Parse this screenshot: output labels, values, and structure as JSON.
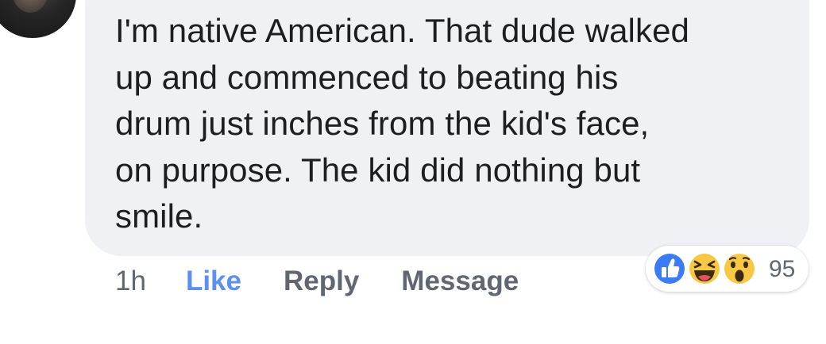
{
  "comment": {
    "lines": [
      "I'm native American. That dude walked",
      "up and commenced to beating his",
      "drum just inches from the kid's face,",
      "on purpose. The kid did nothing but",
      "smile."
    ]
  },
  "actions": {
    "time": "1h",
    "like": "Like",
    "reply": "Reply",
    "message": "Message"
  },
  "reactions": {
    "types": [
      "like",
      "haha",
      "wow"
    ],
    "count": "95",
    "colors": {
      "like": "#3b7bf6",
      "emoji_yellow": "#f7c843",
      "like_text": "#5b8ff0"
    }
  }
}
